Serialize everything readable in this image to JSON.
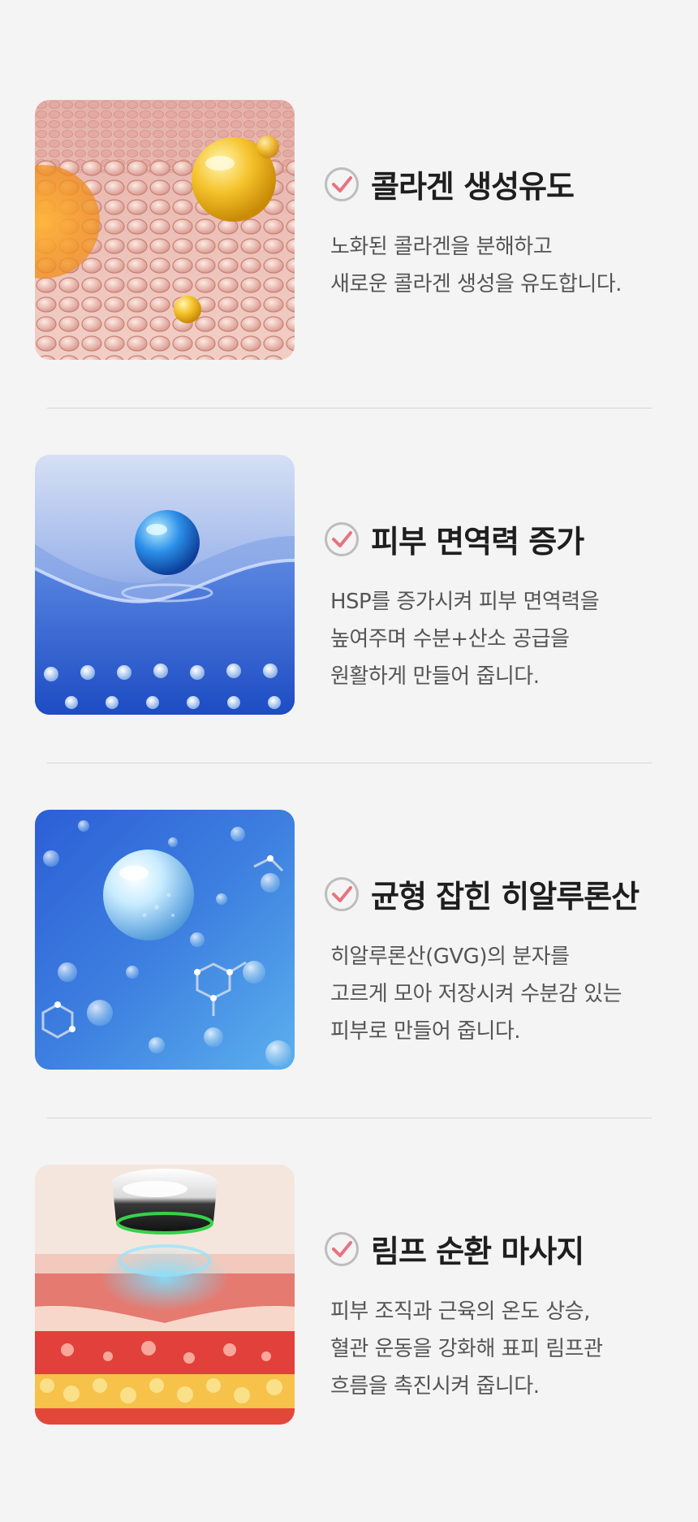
{
  "features": [
    {
      "title": "콜라겐 생성유도",
      "desc": [
        "노화된 콜라겐을 분해하고",
        "새로운 콜라겐 생성을 유도합니다."
      ],
      "image": "collagen-cells-illustration"
    },
    {
      "title": "피부 면역력 증가",
      "desc": [
        "HSP를 증가시켜 피부 면역력을",
        "높여주며 수분+산소 공급을",
        "원활하게 만들어 줍니다."
      ],
      "image": "water-droplet-illustration"
    },
    {
      "title": "균형 잡힌 히알루론산",
      "desc": [
        "히알루론산(GVG)의 분자를",
        "고르게 모아 저장시켜 수분감 있는",
        "피부로 만들어 줍니다."
      ],
      "image": "hyaluronic-molecules-illustration"
    },
    {
      "title": "림프 순환 마사지",
      "desc": [
        "피부 조직과 근육의 온도 상승,",
        "혈관 운동을 강화해 표피 림프관",
        "흐름을 촉진시켜 줍니다."
      ],
      "image": "skin-layers-device-illustration"
    }
  ],
  "colors": {
    "check_ring": "#bdbdbd",
    "check_mark": "#e8727f",
    "title": "#1e1e1e",
    "desc": "#555555",
    "background": "#f4f4f4"
  }
}
